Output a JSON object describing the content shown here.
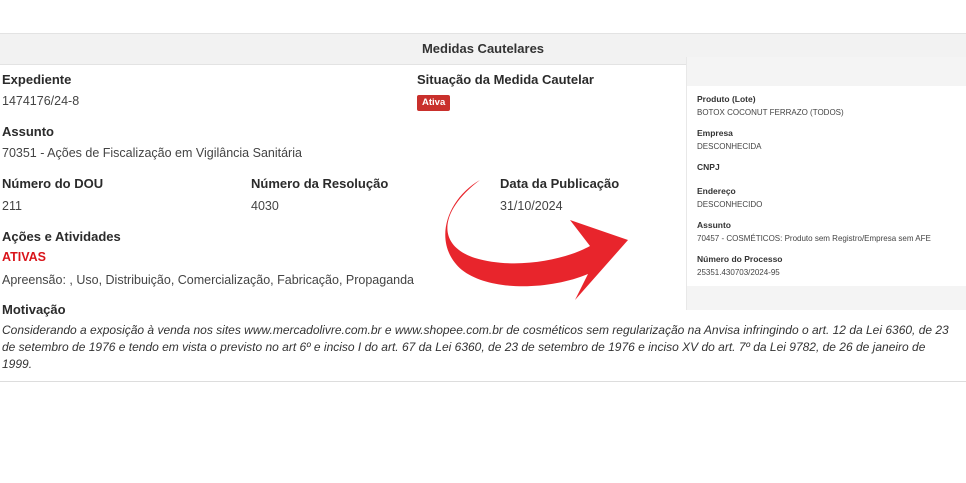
{
  "panel": {
    "title": "Medidas Cautelares"
  },
  "fields": {
    "expediente_label": "Expediente",
    "expediente_value": "1474176/24-8",
    "situacao_label": "Situação da Medida Cautelar",
    "situacao_badge": "Ativa",
    "assunto_label": "Assunto",
    "assunto_value": "70351 - Ações de Fiscalização em Vigilância Sanitária",
    "dou_label": "Número do DOU",
    "dou_value": "211",
    "resolucao_label": "Número da Resolução",
    "resolucao_value": "4030",
    "publicacao_label": "Data da Publicação",
    "publicacao_value": "31/10/2024",
    "acoes_label": "Ações e Atividades",
    "acoes_status": "ATIVAS",
    "acoes_value": "Apreensão: , Uso, Distribuição, Comercialização, Fabricação, Propaganda",
    "motivacao_label": "Motivação",
    "motivacao_text": "Considerando a exposição à venda nos sites www.mercadolivre.com.br e www.shopee.com.br de cosméticos sem regularização na Anvisa infringindo o art. 12 da Lei 6360, de 23 de setembro de 1976 e tendo em vista o previsto no art 6º e inciso I do art. 67 da Lei 6360, de 23 de setembro de 1976 e inciso XV do art. 7º da Lei 9782, de 26 de janeiro de 1999."
  },
  "card": {
    "produto_label": "Produto (Lote)",
    "produto_value": "BOTOX COCONUT FERRAZO (TODOS)",
    "empresa_label": "Empresa",
    "empresa_value": "DESCONHECIDA",
    "cnpj_label": "CNPJ",
    "endereco_label": "Endereço",
    "endereco_value": "DESCONHECIDO",
    "assunto_label": "Assunto",
    "assunto_value": "70457 - COSMÉTICOS: Produto sem Registro/Empresa sem AFE",
    "processo_label": "Número do Processo",
    "processo_value": "25351.430703/2024-95"
  },
  "colors": {
    "badge": "#c9302c",
    "status_red": "#d9141a",
    "arrow": "#e8252c"
  },
  "icons": {
    "annotation": "curved-arrow-icon"
  }
}
